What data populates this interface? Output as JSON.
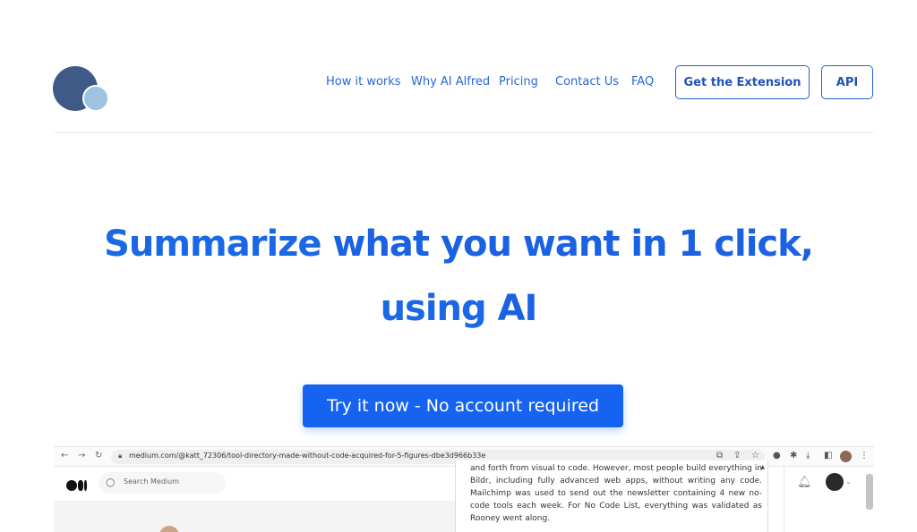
{
  "nav": {
    "items": [
      "How it works",
      "Why AI Alfred",
      "Pricing",
      "Contact Us",
      "FAQ"
    ],
    "extension_button": "Get the Extension",
    "api_button": "API"
  },
  "hero": {
    "line1_light": "Summarize ",
    "line1_bold": "what you want in 1 click,",
    "line2_light": "using ",
    "line2_bold": "AI"
  },
  "cta": {
    "label": "Try it now - No account required"
  },
  "screenshot": {
    "url": "medium.com/@katt_72306/tool-directory-made-without-code-acquired-for-5-figures-dbe3d966b33e",
    "search_placeholder": "Search Medium",
    "popup_text": "and forth from visual to code. However, most people build everything in Bildr, including fully advanced web apps, without writing any code. Mailchimp was used to send out the newsletter containing 4 new no-code tools each week. For No Code List, everything was validated as Rooney went along."
  },
  "colors": {
    "brand_blue": "#1563f0",
    "logo_dark": "#3f5a86",
    "logo_light": "#9dc3e0"
  }
}
